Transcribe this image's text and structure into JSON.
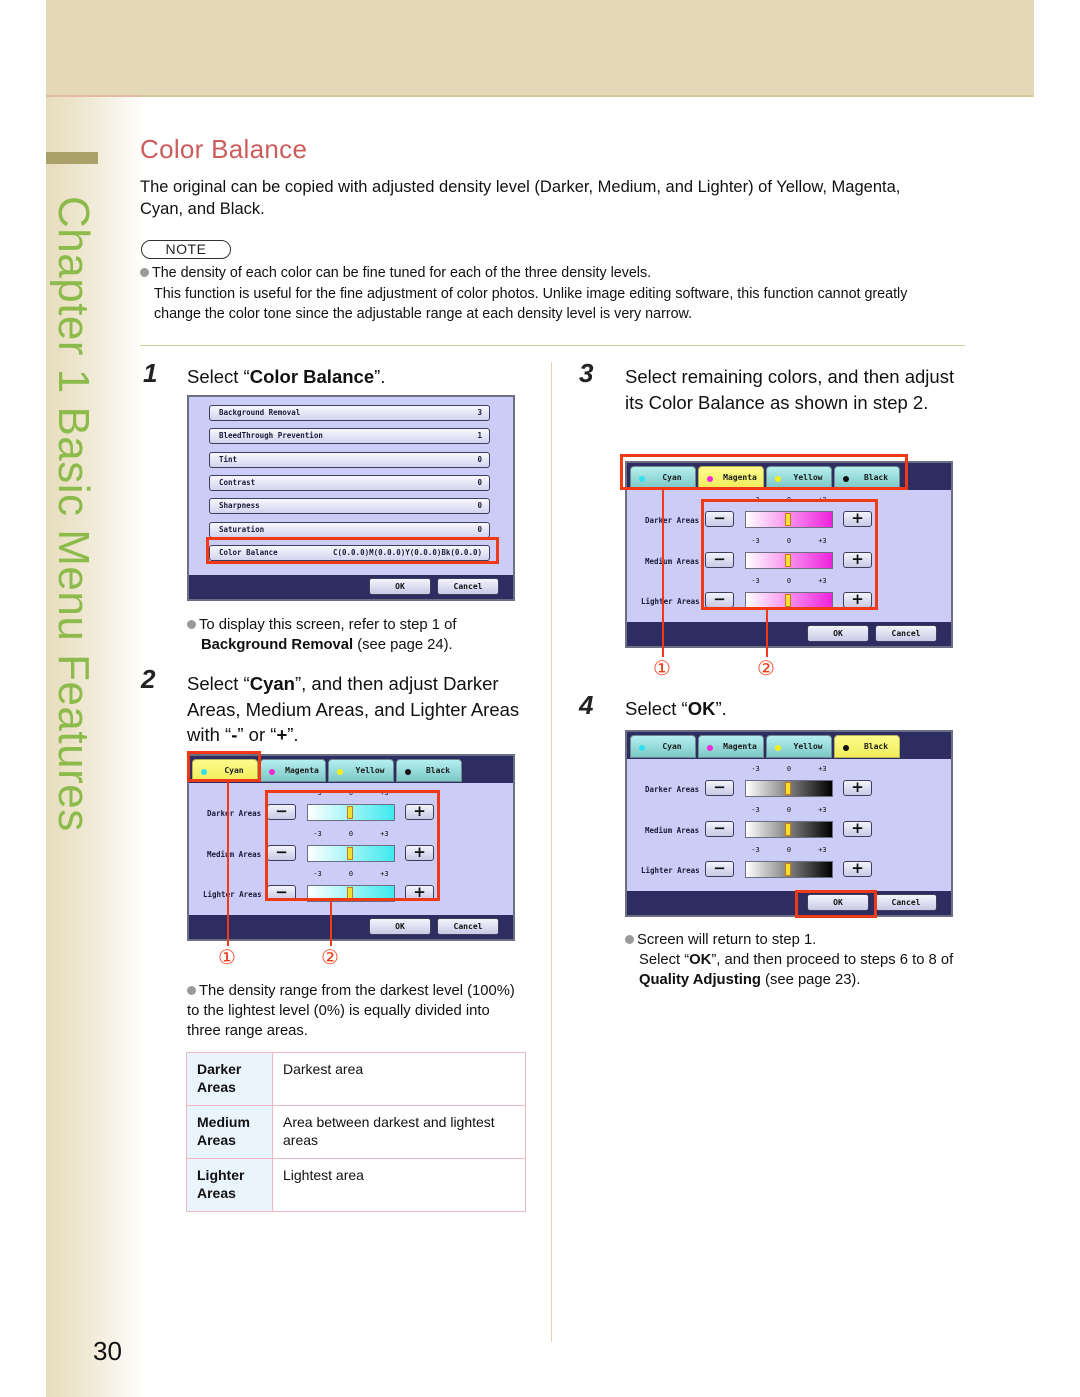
{
  "page": {
    "number": "30",
    "chapter_label": "Chapter 1   Basic Menu Features",
    "colors": {
      "title": "#cd5c5c",
      "chapter": "#8cbb4c",
      "highlight": "#f03a17",
      "band": "#e3d9b7"
    }
  },
  "section": {
    "title": "Color Balance",
    "intro": "The original can be copied with adjusted density level (Darker, Medium, and Lighter) of Yellow, Magenta, Cyan, and Black.",
    "note_label": "NOTE",
    "note_line1": "The density of each color can be fine tuned for each of the three density levels.",
    "note_line2": "This function is useful for the fine adjustment of color photos. Unlike image editing software, this function cannot greatly change the color tone since the adjustable range at each density level is very narrow."
  },
  "step1": {
    "num": "1",
    "pre": "Select “",
    "bold": "Color Balance",
    "post": "”.",
    "note_pre": "To display this screen, refer to step 1 of",
    "note_bold": "Background Removal",
    "note_post": " (see page 24).",
    "screen": {
      "items": [
        {
          "label": "Background Removal",
          "value": "3"
        },
        {
          "label": "BleedThrough Prevention",
          "value": "1"
        },
        {
          "label": "Tint",
          "value": "0"
        },
        {
          "label": "Contrast",
          "value": "0"
        },
        {
          "label": "Sharpness",
          "value": "0"
        },
        {
          "label": "Saturation",
          "value": "0"
        },
        {
          "label": "Color Balance",
          "value": "C(0.0.0)M(0.0.0)Y(0.0.0)Bk(0.0.0)"
        }
      ],
      "ok": "OK",
      "cancel": "Cancel"
    }
  },
  "step2": {
    "num": "2",
    "pre": "Select “",
    "bold": "Cyan",
    "mid": "”, and then adjust Darker Areas, Medium Areas, and Lighter Areas with “",
    "minus": "-",
    "or": "” or “",
    "plus": "+",
    "post": "”.",
    "callouts": [
      "①",
      "②"
    ],
    "note": "The density range from the darkest level (100%) to the lightest level (0%) is equally divided into three range areas."
  },
  "step3": {
    "num": "3",
    "text": "Select remaining colors, and then adjust its Color Balance as shown in step 2.",
    "callouts": [
      "①",
      "②"
    ]
  },
  "step4": {
    "num": "4",
    "pre": "Select “",
    "bold": "OK",
    "post": "”.",
    "note_line1": "Screen will return to step 1.",
    "note_pre": "Select “",
    "note_bold1": "OK",
    "note_mid": "”, and then proceed to steps 6 to 8 of ",
    "note_bold2": "Quality Adjusting",
    "note_post": " (see page 23)."
  },
  "color_screen": {
    "tabs": [
      {
        "label": "Cyan",
        "dot": "#2fe0f0"
      },
      {
        "label": "Magenta",
        "dot": "#f02ad8"
      },
      {
        "label": "Yellow",
        "dot": "#f5ee1a"
      },
      {
        "label": "Black",
        "dot": "#111111"
      }
    ],
    "rows": [
      "Darker Areas",
      "Medium Areas",
      "Lighter Areas"
    ],
    "scale": [
      "-3",
      "0",
      "+3"
    ],
    "level": 0,
    "minus_label": "−",
    "plus_label": "+",
    "ok": "OK",
    "cancel": "Cancel",
    "gradients": {
      "Cyan": [
        "#ffffff",
        "#3ee9ef"
      ],
      "Magenta": [
        "#ffffff",
        "#ee22dc"
      ],
      "Black": [
        "#ffffff",
        "#000000"
      ]
    }
  },
  "table": {
    "rows": [
      {
        "head": "Darker Areas",
        "desc": "Darkest area"
      },
      {
        "head": "Medium Areas",
        "desc": "Area between darkest and lightest areas"
      },
      {
        "head": "Lighter Areas",
        "desc": "Lightest area"
      }
    ]
  }
}
